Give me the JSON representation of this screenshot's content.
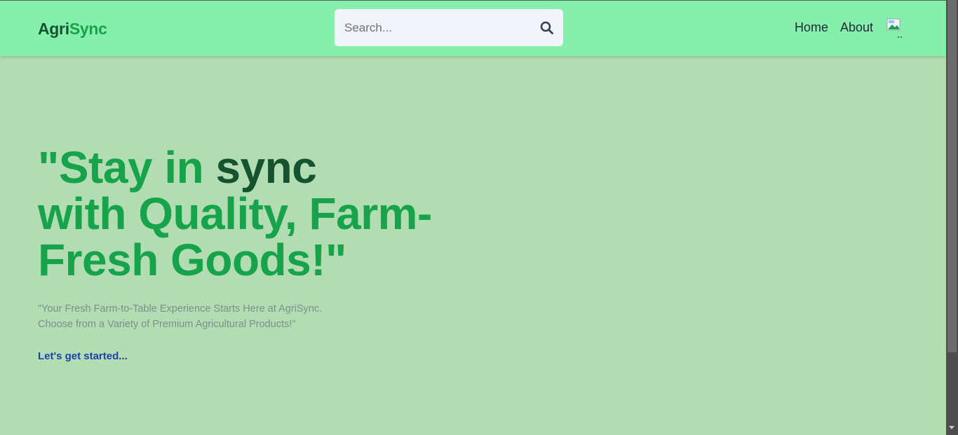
{
  "brand": {
    "part1": "Agri",
    "part2": "Sync"
  },
  "search": {
    "placeholder": "Search..."
  },
  "nav": {
    "home": "Home",
    "about": "About"
  },
  "hero": {
    "line1_a": "\"Stay in ",
    "line1_b": "sync",
    "line2": "with Quality, Farm-",
    "line3": "Fresh Goods!\""
  },
  "subtext": {
    "line1": "\"Your Fresh Farm-to-Table Experience Starts Here at AgriSync.",
    "line2": "Choose from a Variety of Premium Agricultural Products!\""
  },
  "cta": {
    "label": "Let's get started..."
  },
  "colors": {
    "navbar": "#86efac",
    "background": "#b2ddb3",
    "brand_dark": "#14532d",
    "brand_accent": "#16a34a",
    "link": "#1e40af"
  },
  "icons": {
    "search": "search-icon",
    "avatar": "broken-image-icon"
  }
}
